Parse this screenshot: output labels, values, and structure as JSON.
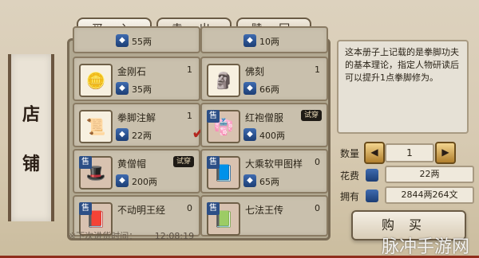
{
  "tabs": [
    "买 入",
    "卖 出",
    "赎 回"
  ],
  "scroll": {
    "title_chars": [
      "店",
      "铺"
    ]
  },
  "grid": {
    "top_row": [
      {
        "name": "",
        "qty": "",
        "price": "55两"
      },
      {
        "name": "",
        "qty": "",
        "price": "10两"
      }
    ],
    "rows": [
      [
        {
          "name": "金刚石",
          "qty": "1",
          "price": "35两",
          "icon": "gold-ingot-icon",
          "sale": false,
          "try": false,
          "checked": false
        },
        {
          "name": "佛刻",
          "qty": "1",
          "price": "66两",
          "icon": "buddha-statue-icon",
          "sale": false,
          "try": false,
          "checked": false
        }
      ],
      [
        {
          "name": "拳脚注解",
          "qty": "1",
          "price": "22两",
          "icon": "scroll-book-icon",
          "sale": false,
          "try": false,
          "checked": true
        },
        {
          "name": "红袍僧服",
          "qty": "",
          "price": "400两",
          "icon": "monk-robe-icon",
          "sale": true,
          "try": true,
          "checked": false
        }
      ],
      [
        {
          "name": "黄僧帽",
          "qty": "",
          "price": "200两",
          "icon": "monk-hat-icon",
          "sale": true,
          "try": true,
          "checked": false
        },
        {
          "name": "大乘软甲图样",
          "qty": "0",
          "price": "65两",
          "icon": "armor-pattern-icon",
          "sale": true,
          "try": false,
          "checked": false
        }
      ],
      [
        {
          "name": "不动明王经",
          "qty": "0",
          "price": "",
          "icon": "sutra-book-icon",
          "sale": true,
          "try": false,
          "checked": false
        },
        {
          "name": "七法王传",
          "qty": "0",
          "price": "",
          "icon": "legend-book-icon",
          "sale": true,
          "try": false,
          "checked": false
        }
      ]
    ],
    "sale_label": "售",
    "try_label": "试穿"
  },
  "description": "这本册子上记载的是拳脚功夫的基本理论，指定人物研读后可以提升1点拳脚修为。",
  "purchase": {
    "quantity_label": "数量",
    "quantity": "1",
    "cost_label": "花费",
    "cost": "22两",
    "owned_label": "拥有",
    "owned": "2844两264文",
    "buy_label": "购买"
  },
  "footer": {
    "restock_label": "※下次进货时间：",
    "restock_time": "12:08:19"
  },
  "watermark": "脉冲手游网"
}
